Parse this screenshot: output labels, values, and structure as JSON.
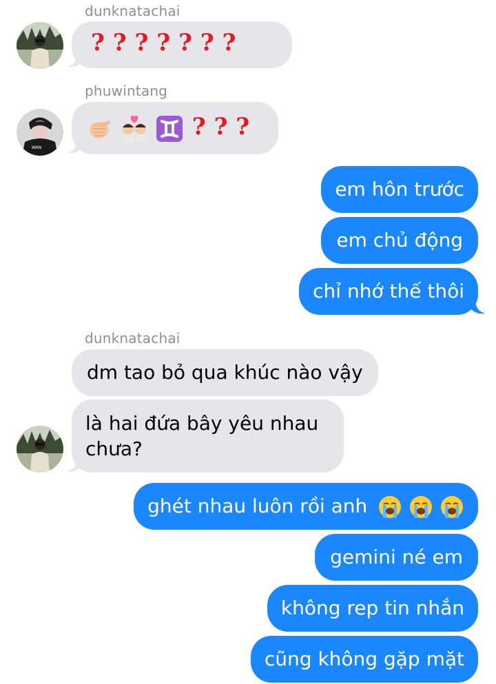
{
  "messages": [
    {
      "sender": "dunknatachai",
      "text": "? ? ? ? ? ? ?"
    },
    {
      "sender": "phuwintang",
      "emoji_icons": [
        "pointing-fist-emoji",
        "kiss-couple-emoji",
        "gemini-sign-emoji"
      ],
      "text": "? ? ?"
    },
    {
      "text": "em hôn trước"
    },
    {
      "text": "em chủ động"
    },
    {
      "text": "chỉ nhớ thế thôi"
    },
    {
      "sender": "dunknatachai",
      "text": "dm tao bỏ qua khúc nào vậy"
    },
    {
      "text": "là hai đứa bây yêu nhau chưa?"
    },
    {
      "text": "ghét nhau luôn rồi anh",
      "emoji_icons": [
        "loudly-crying-face-emoji",
        "loudly-crying-face-emoji",
        "loudly-crying-face-emoji"
      ]
    },
    {
      "text": "gemini né em"
    },
    {
      "text": "không rep tin nhắn"
    },
    {
      "text": "cũng không gặp mặt"
    }
  ],
  "colors": {
    "incoming_bubble": "#e5e5ea",
    "outgoing_bubble": "#1a87ff",
    "sender_name": "#8e8e93",
    "question_mark": "#e01b24"
  }
}
